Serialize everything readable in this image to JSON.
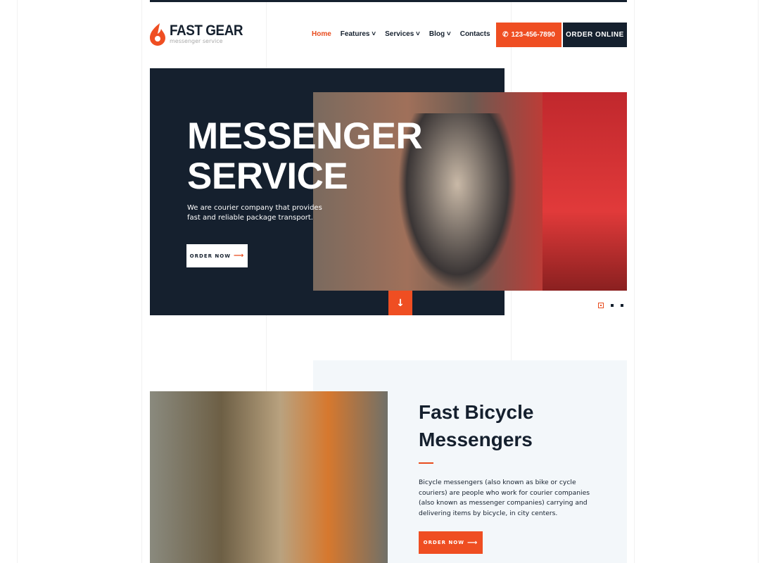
{
  "brand": {
    "name": "FAST GEAR",
    "tagline": "messenger service",
    "accent": "#ef4e22",
    "dark": "#15202e"
  },
  "nav": [
    {
      "label": "Home",
      "active": true
    },
    {
      "label": "Features ˅"
    },
    {
      "label": "Services ˅"
    },
    {
      "label": "Blog ˅"
    },
    {
      "label": "Contacts"
    }
  ],
  "header": {
    "phone": "123-456-7890",
    "phone_icon": "phone-icon",
    "order_label": "ORDER ONLINE"
  },
  "hero": {
    "title_line1": "MESSENGER",
    "title_line2": "SERVICE",
    "subtitle": "We are courier company that provides fast and reliable package transport.",
    "button": "ORDER NOW",
    "arrow": "⟶",
    "scroll_icon": "↓",
    "slides": 3,
    "active_slide": 1
  },
  "section": {
    "title_line1": "Fast Bicycle",
    "title_line2": "Messengers",
    "body": "Bicycle messengers (also known as bike or cycle couriers) are people who work for courier companies (also known as messenger companies) carrying and delivering items by bicycle, in city centers.",
    "button": "ORDER NOW"
  }
}
